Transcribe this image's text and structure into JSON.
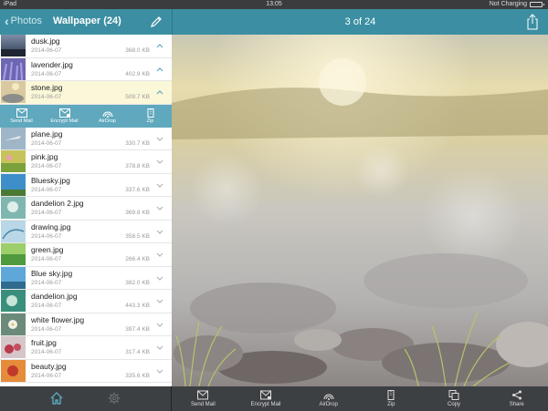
{
  "status_bar": {
    "device": "iPad",
    "time": "13:05",
    "battery_text": "Not Charging"
  },
  "nav": {
    "back_label": "Photos",
    "title": "Wallpaper (24)",
    "photo_counter": "3 of 24"
  },
  "files": [
    {
      "name": "dusk.jpg",
      "date": "2014-06-07",
      "size": "368.0 KB",
      "expanded": true
    },
    {
      "name": "lavender.jpg",
      "date": "2014-06-07",
      "size": "402.9 KB",
      "expanded": true
    },
    {
      "name": "stone.jpg",
      "date": "2014-06-07",
      "size": "509.7 KB",
      "expanded": true,
      "selected": true
    },
    {
      "name": "plane.jpg",
      "date": "2014-06-07",
      "size": "330.7 KB"
    },
    {
      "name": "pink.jpg",
      "date": "2014-06-07",
      "size": "378.8 KB"
    },
    {
      "name": "Bluesky.jpg",
      "date": "2014-06-07",
      "size": "337.6 KB"
    },
    {
      "name": "dandelion 2.jpg",
      "date": "2014-06-07",
      "size": "369.8 KB"
    },
    {
      "name": "drawing.jpg",
      "date": "2014-06-07",
      "size": "358.5 KB"
    },
    {
      "name": "green.jpg",
      "date": "2014-06-07",
      "size": "266.4 KB"
    },
    {
      "name": "Blue sky.jpg",
      "date": "2014-06-07",
      "size": "382.0 KB"
    },
    {
      "name": "dandelion.jpg",
      "date": "2014-06-07",
      "size": "443.3 KB"
    },
    {
      "name": "white flower.jpg",
      "date": "2014-06-07",
      "size": "397.4 KB"
    },
    {
      "name": "fruit.jpg",
      "date": "2014-06-07",
      "size": "317.4 KB"
    },
    {
      "name": "beauty.jpg",
      "date": "2014-06-07",
      "size": "335.6 KB"
    }
  ],
  "row_actions": {
    "send_mail": "Send Mail",
    "encrypt_mail": "Encrypt Mail",
    "airdrop": "AirDrop",
    "zip": "Zip"
  },
  "toolbar": {
    "send_mail": "Send Mail",
    "encrypt_mail": "Encrypt Mail",
    "airdrop": "AirDrop",
    "zip": "Zip",
    "copy": "Copy",
    "share": "Share"
  },
  "tabs": {
    "home_icon": "home-icon",
    "settings_icon": "gear-icon"
  },
  "colors": {
    "nav": "#3c8fa2",
    "action_bar": "#5fa8bd",
    "selected_row": "#fbf7d9",
    "toolbar": "#3d4043"
  }
}
